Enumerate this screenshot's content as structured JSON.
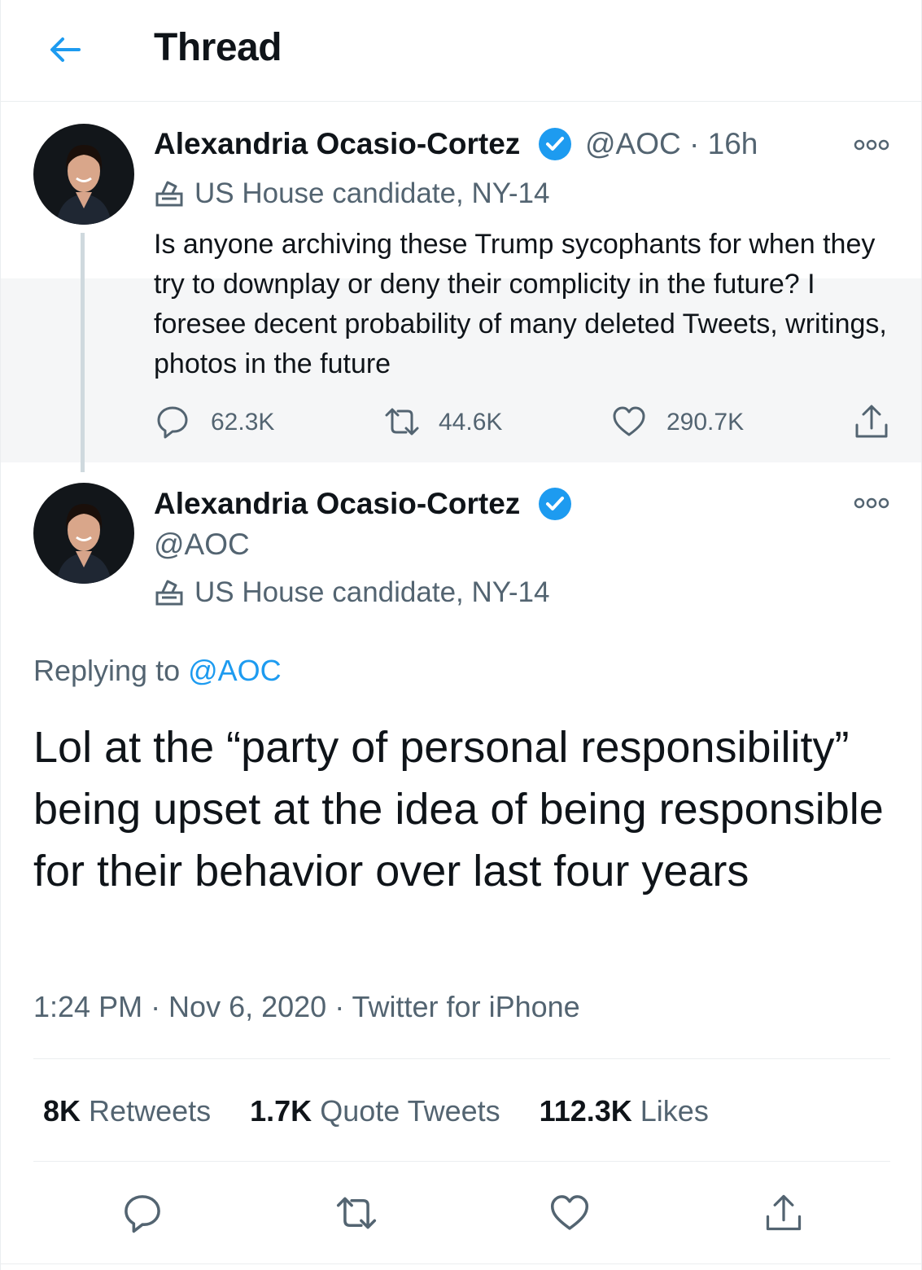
{
  "header": {
    "title": "Thread"
  },
  "tweets": [
    {
      "name": "Alexandria Ocasio-Cortez",
      "handle": "@AOC",
      "separator": "·",
      "time": "16h",
      "label": "US House candidate, NY-14",
      "text": "Is anyone archiving these Trump sycophants for when they try to downplay or deny their complicity in the future? I foresee decent probability of many deleted Tweets, writings, photos in the future",
      "replies": "62.3K",
      "retweets": "44.6K",
      "likes": "290.7K"
    },
    {
      "name": "Alexandria Ocasio-Cortez",
      "handle": "@AOC",
      "label": "US House candidate, NY-14",
      "replying_prefix": "Replying to",
      "replying_to": "@AOC",
      "text": "Lol at the “party of personal responsibility” being upset at the idea of being responsible for their behavior over last four years",
      "timestamp": "1:24 PM · Nov 6, 2020 · Twitter for iPhone",
      "stats": [
        {
          "count": "8K",
          "label": "Retweets"
        },
        {
          "count": "1.7K",
          "label": "Quote Tweets"
        },
        {
          "count": "112.3K",
          "label": "Likes"
        }
      ]
    }
  ],
  "colors": {
    "accent": "#1d9bf0",
    "muted": "#536471",
    "text": "#0f1419",
    "hover_bg": "#f5f6f7",
    "divider": "#ebeef0"
  },
  "icons": [
    "back-arrow-icon",
    "verified-badge-icon",
    "more-icon",
    "ballot-box-icon",
    "reply-icon",
    "retweet-icon",
    "like-icon",
    "share-icon"
  ]
}
